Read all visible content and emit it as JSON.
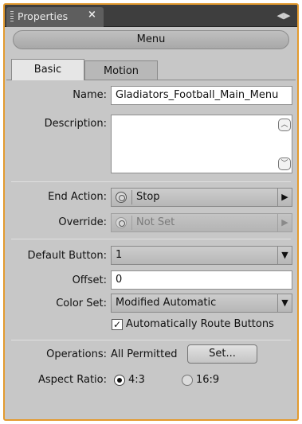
{
  "panel": {
    "tab_title": "Properties",
    "tab_close": "×",
    "menu_glyph": "◀▶",
    "object_type": "Menu"
  },
  "tabs": [
    {
      "label": "Basic",
      "active": true
    },
    {
      "label": "Motion",
      "active": false
    }
  ],
  "fields": {
    "name": {
      "label": "Name:",
      "value": "Gladiators_Football_Main_Menu"
    },
    "description": {
      "label": "Description:",
      "value": ""
    },
    "end_action": {
      "label": "End Action:",
      "value": "Stop"
    },
    "override": {
      "label": "Override:",
      "value": "Not Set",
      "disabled": true
    },
    "default_button": {
      "label": "Default Button:",
      "value": "1"
    },
    "offset": {
      "label": "Offset:",
      "value": "0"
    },
    "color_set": {
      "label": "Color Set:",
      "value": "Modified Automatic"
    },
    "auto_route": {
      "label": "Automatically Route Buttons",
      "checked": true
    },
    "operations": {
      "label": "Operations:",
      "value": "All Permitted",
      "button": "Set..."
    },
    "aspect_ratio": {
      "label": "Aspect Ratio:",
      "options": [
        {
          "label": "4:3",
          "selected": true
        },
        {
          "label": "16:9",
          "selected": false
        }
      ]
    }
  },
  "colors": {
    "frame_border": "#e39a2e",
    "panel_bg": "#c7c7c7",
    "titlebar_bg": "#3e3e3e"
  }
}
